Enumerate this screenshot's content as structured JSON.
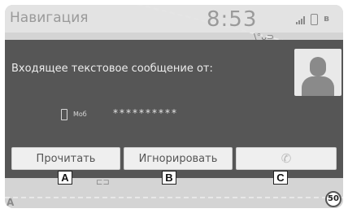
{
  "status": {
    "app_title": "Навигация",
    "time": "8:53",
    "signal_icon": "signal-icon",
    "phone_icon": "phone-icon",
    "bluetooth_icon": "bluetooth-icon",
    "bluetooth_glyph": "ʙ"
  },
  "map": {
    "fragment_top": "\\°ᴗ⊃",
    "sign_left": "⊏⊐",
    "corner_label": "A",
    "speed_limit": "50"
  },
  "message": {
    "title": "Входящее текстовое сообщение от:",
    "contact_type": "Моб",
    "number": "**********",
    "avatar_icon": "contact-avatar-icon"
  },
  "actions": {
    "read_label": "Прочитать",
    "ignore_label": "Игнорировать",
    "call_icon": "phone-call-icon",
    "call_glyph": "✆"
  },
  "callouts": {
    "a": "A",
    "b": "B",
    "c": "C"
  },
  "colors": {
    "panel_bg": "#565656",
    "button_bg": "#efefef",
    "map_bg": "#d4d4d4"
  }
}
